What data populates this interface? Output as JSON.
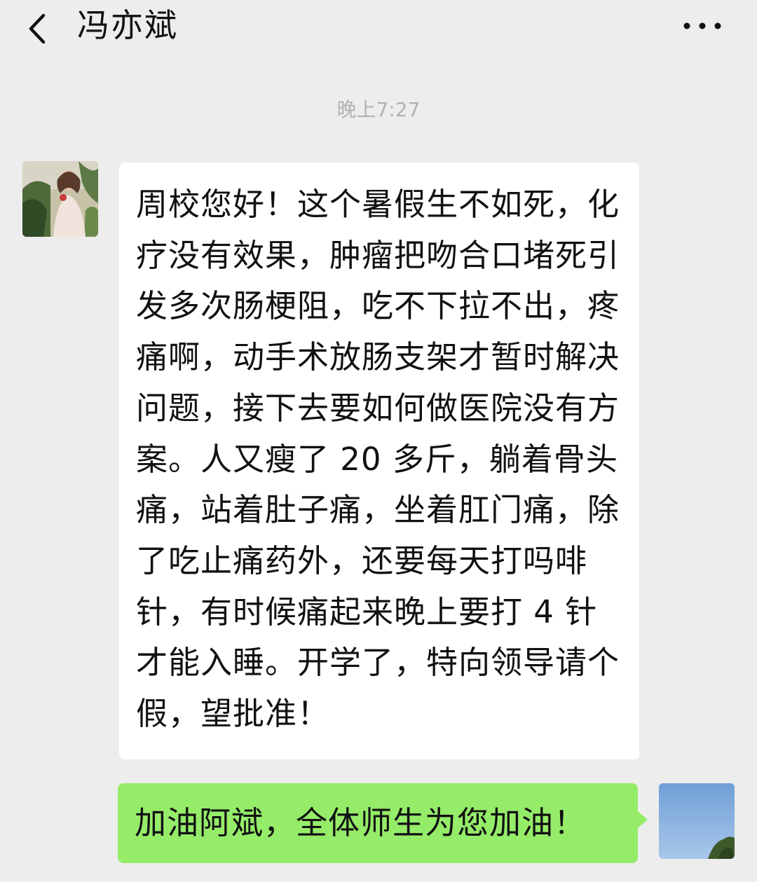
{
  "header": {
    "back_icon": "chevron-left-icon",
    "title": "冯亦斌",
    "more_icon": "more-horizontal-icon"
  },
  "chat": {
    "timestamp": "晚上7:27",
    "messages": [
      {
        "sender": "contact",
        "text": "周校您好！这个暑假生不如死，化疗没有效果，肿瘤把吻合口堵死引发多次肠梗阻，吃不下拉不出，疼痛啊，动手术放肠支架才暂时解决问题，接下去要如何做医院没有方案。人又瘦了 20 多斤，躺着骨头痛，站着肚子痛，坐着肛门痛，除了吃止痛药外，还要每天打吗啡针，有时候痛起来晚上要打 4 针才能入睡。开学了，特向领导请个假，望批准！"
      },
      {
        "sender": "me",
        "text": "加油阿斌，全体师生为您加油！"
      }
    ]
  },
  "colors": {
    "background": "#ededed",
    "incoming_bubble": "#ffffff",
    "outgoing_bubble": "#95ec69",
    "timestamp_text": "#b2b2b2"
  }
}
